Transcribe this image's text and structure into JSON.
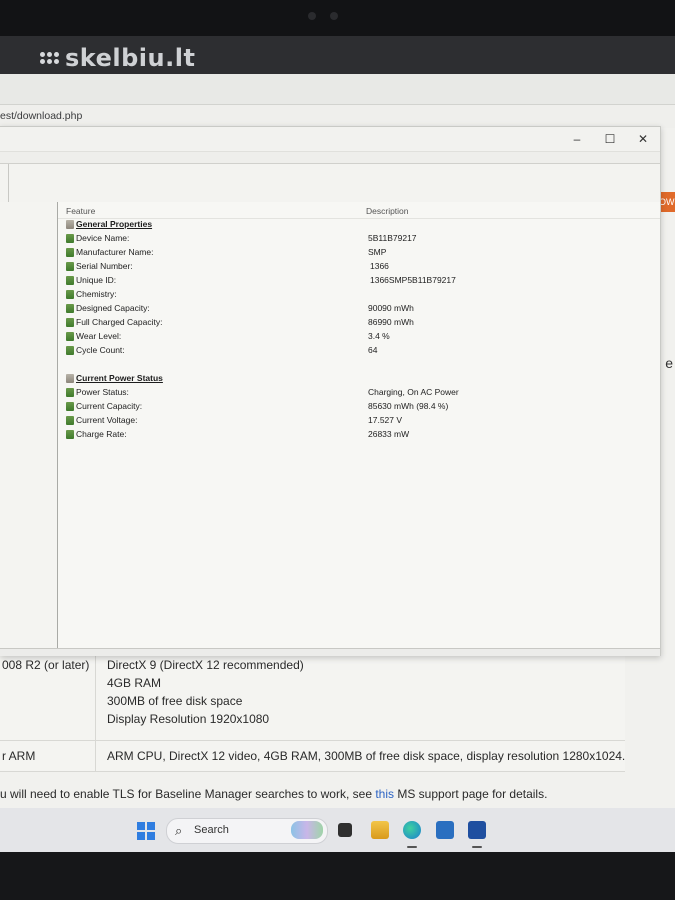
{
  "banner": {
    "logo_text": "skelbiu.lt"
  },
  "browser": {
    "address": "est/download.php"
  },
  "background_page": {
    "side_tab_text": "OW",
    "side_letter": "e",
    "requirements": [
      {
        "left": "008 R2 (or later)",
        "right": [
          "DirectX 9 (DirectX 12 recommended)",
          "4GB RAM",
          "300MB of free disk space",
          "Display Resolution 1920x1080"
        ]
      },
      {
        "left": "r ARM",
        "right": [
          "ARM CPU, DirectX 12 video, 4GB RAM, 300MB of free disk space, display resolution 1280x1024."
        ]
      }
    ],
    "tls_note_before": "u will need to enable TLS for Baseline Manager searches to work, see ",
    "tls_note_link": "this",
    "tls_note_after": " MS support page for details."
  },
  "window": {
    "controls": {
      "minimize": "–",
      "maximize": "☐",
      "close": "✕"
    },
    "columns": {
      "feature": "Feature",
      "description": "Description"
    },
    "groups": [
      {
        "title": "General Properties",
        "items": [
          {
            "label": "Device Name:",
            "value": "5B11B79217"
          },
          {
            "label": "Manufacturer Name:",
            "value": "SMP"
          },
          {
            "label": "Serial Number:",
            "value": "1366"
          },
          {
            "label": "Unique ID:",
            "value": "1366SMP5B11B79217"
          },
          {
            "label": "Chemistry:",
            "value": ""
          },
          {
            "label": "Designed Capacity:",
            "value": "90090 mWh"
          },
          {
            "label": "Full Charged Capacity:",
            "value": "86990 mWh"
          },
          {
            "label": "Wear Level:",
            "value": "3.4 %"
          },
          {
            "label": "Cycle Count:",
            "value": "64"
          }
        ]
      },
      {
        "title": "Current Power Status",
        "items": [
          {
            "label": "Power Status:",
            "value": "Charging, On AC Power"
          },
          {
            "label": "Current Capacity:",
            "value": "85630 mWh (98.4 %)"
          },
          {
            "label": "Current Voltage:",
            "value": "17.527 V"
          },
          {
            "label": "Charge Rate:",
            "value": "26833 mW"
          }
        ]
      }
    ]
  },
  "taskbar": {
    "search_label": "Search",
    "search_glyph": "⌕",
    "icons": [
      {
        "name": "task-view-icon",
        "color": "#3a3a3a"
      },
      {
        "name": "file-explorer-icon",
        "color": "#e8b22a"
      },
      {
        "name": "edge-icon",
        "color": "#1a8bd0"
      },
      {
        "name": "store-icon",
        "color": "#2a6fc0"
      },
      {
        "name": "app-icon",
        "color": "#1f4fa0"
      }
    ]
  }
}
